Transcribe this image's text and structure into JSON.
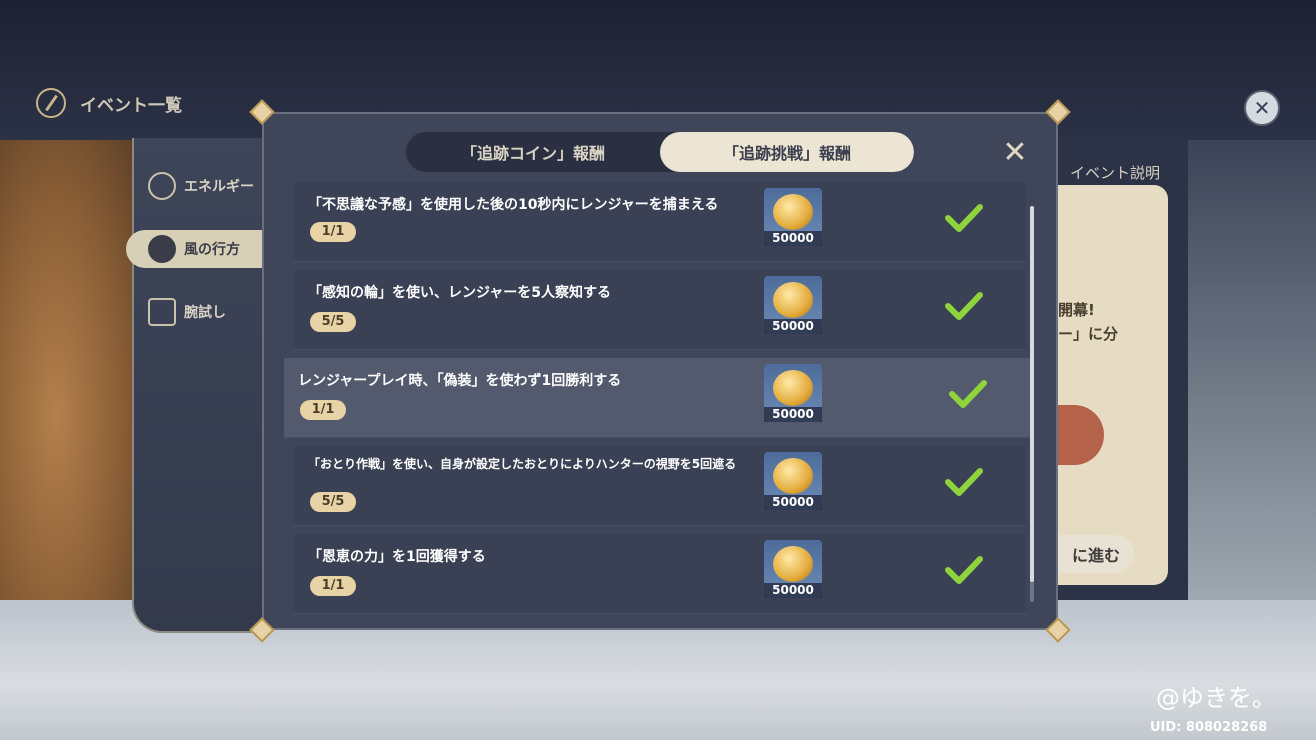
{
  "event_header": {
    "title": "イベント一覧"
  },
  "sidebar": {
    "items": [
      {
        "label": "エネルギー",
        "icon": "compass-icon"
      },
      {
        "label": "風の行方",
        "icon": "masked-cat-icon"
      },
      {
        "label": "腕試し",
        "icon": "cards-icon"
      }
    ]
  },
  "right_panel": {
    "label": "イベント説明",
    "line1": "開幕!",
    "line2": "ー」に分",
    "button": "に進む"
  },
  "dialog": {
    "tabs": [
      {
        "label": "「追跡コイン」報酬"
      },
      {
        "label": "「追跡挑戦」報酬"
      }
    ],
    "active_tab": 1,
    "challenges": [
      {
        "description": "「不思議な予感」を使用した後の10秒内にレンジャーを捕まえる",
        "progress": "1/1",
        "reward_amount": "50000",
        "completed": true
      },
      {
        "description": "「感知の輪」を使い、レンジャーを5人察知する",
        "progress": "5/5",
        "reward_amount": "50000",
        "completed": true
      },
      {
        "description": "レンジャープレイ時、「偽装」を使わず1回勝利する",
        "progress": "1/1",
        "reward_amount": "50000",
        "completed": true
      },
      {
        "description": "「おとり作戦」を使い、自身が設定したおとりによりハンターの視野を5回遮る",
        "progress": "5/5",
        "reward_amount": "50000",
        "completed": true
      },
      {
        "description": "「恩恵の力」を1回獲得する",
        "progress": "1/1",
        "reward_amount": "50000",
        "completed": true
      }
    ]
  },
  "watermark": "@ゆきを。",
  "uid": "UID: 808028268",
  "colors": {
    "check": "#8fd43c",
    "badge": "#e7d3a6",
    "tab_active": "#ece5d4",
    "panel": "#3f4659"
  }
}
